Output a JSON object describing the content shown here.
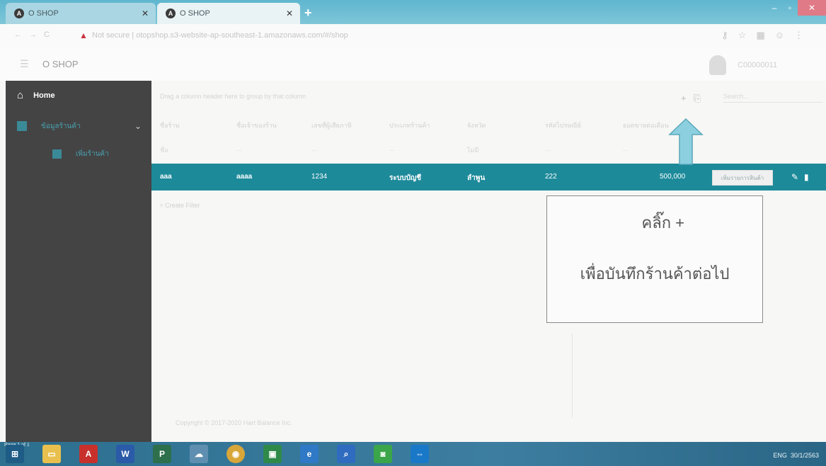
{
  "browser": {
    "tabs": [
      {
        "title": "O SHOP",
        "close": "✕"
      },
      {
        "title": "O SHOP",
        "close": "✕"
      }
    ],
    "new_tab": "+",
    "not_secure": "Not secure",
    "url": "otopshop.s3-website-ap-southeast-1.amazonaws.com/#/shop",
    "window_min": "–",
    "window_max": "▫",
    "window_close": "✕"
  },
  "app": {
    "brand": "O SHOP",
    "user": "C00000011"
  },
  "sidebar": {
    "home": "Home",
    "group": "ข้อมูลร้านค้า",
    "sub_item": "เพิ่มร้านค้า"
  },
  "grid": {
    "group_hint": "Drag a column header here to group by that column",
    "search_placeholder": "Search...",
    "columns": [
      "ชื่อร้าน",
      "ชื่อเจ้าของร้าน",
      "เลขที่ผู้เสียภาษี",
      "ประเภทร้านค้า",
      "จังหวัด",
      "รหัสไปรษณีย์",
      "ยอดขายต่อเดือน"
    ],
    "filter_row": [
      "ชื่อ",
      "...",
      "...",
      "...",
      "ไม่มี",
      "...",
      "..."
    ],
    "row": {
      "c1": "aaa",
      "c2": "aaaa",
      "c3": "1234",
      "c4": "ระบบบัญชี",
      "c5": "ลำพูน",
      "c6": "222",
      "c7": "500,000",
      "button": "เพิ่มรายการสินค้า"
    },
    "create_filter": "Create Filter"
  },
  "footer": "Copyright © 2017-2020 Hart Balance Inc.",
  "annotation": {
    "line1": "คลิ๊ก +",
    "line2": "เพื่อบันทึกร้านค้าต่อไป",
    "arrow_color": "#8cd0e0"
  },
  "taskbar": {
    "lang": "ENG",
    "date": "30/1/2563",
    "page_status": "Page 1 of 1"
  },
  "colors": {
    "accent": "#1d8a9a",
    "sidebar": "#444444"
  }
}
